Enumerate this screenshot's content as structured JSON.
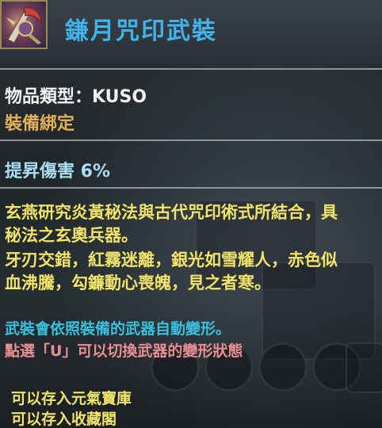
{
  "item": {
    "name": "鎌月咒印武裝",
    "icon": "weapon-armor-icon"
  },
  "attributes": {
    "type_label": "物品類型：KUSO",
    "bind_status": "裝備綁定",
    "stat": "提昇傷害 6%"
  },
  "description": {
    "paragraph_1": [
      "玄燕研究炎黃秘法與古代咒印術式所結合，具",
      "秘法之玄奧兵器。"
    ],
    "paragraph_2": [
      "牙刃交錯，紅霧迷離，銀光如雪耀人，赤色似",
      "血沸騰，勾鐮動心喪魄，見之者寒。"
    ]
  },
  "notes": {
    "transform": "武裝會依照裝備的武器自動變形。",
    "switch_hint": "點選「U」可以切換武器的變形狀態"
  },
  "storage": {
    "line_1": "可以存入元氣寶庫",
    "line_2": "可以存入收藏閣"
  },
  "colors": {
    "name": "#3fb3ea",
    "bind": "#e0b15a",
    "stat": "#a9dff2",
    "description": "#f0e46a",
    "transform": "#39c2de",
    "switch_hint": "#e98f93"
  }
}
